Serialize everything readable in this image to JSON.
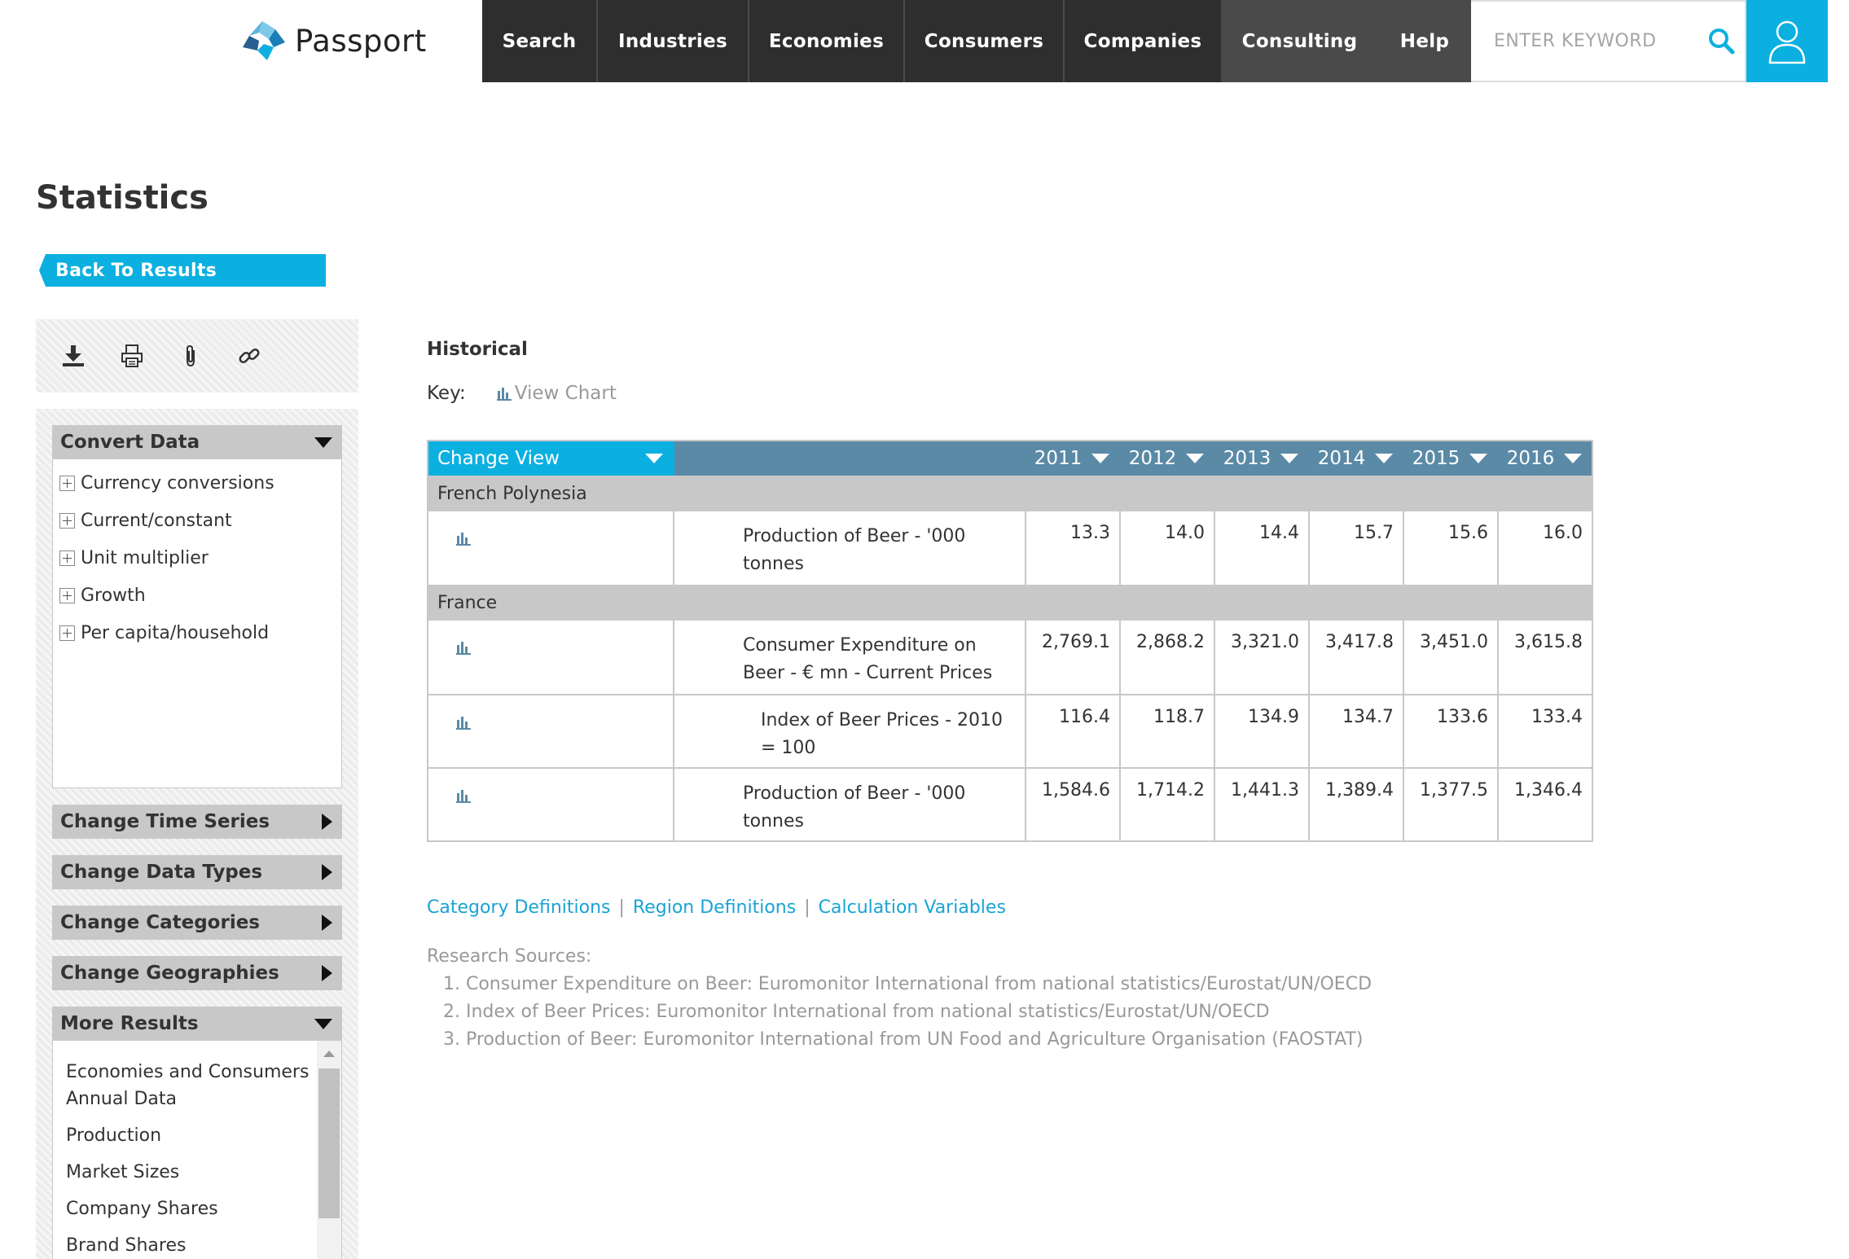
{
  "header": {
    "logo_text": "Passport",
    "nav": [
      {
        "label": "Search",
        "name": "nav-search"
      },
      {
        "label": "Industries",
        "name": "nav-industries"
      },
      {
        "label": "Economies",
        "name": "nav-economies"
      },
      {
        "label": "Consumers",
        "name": "nav-consumers"
      },
      {
        "label": "Companies",
        "name": "nav-companies"
      },
      {
        "label": "Consulting",
        "name": "nav-consulting"
      },
      {
        "label": "Help",
        "name": "nav-help"
      }
    ],
    "search_placeholder": "ENTER KEYWORD",
    "accent_color": "#0bb0e0"
  },
  "page": {
    "title": "Statistics",
    "back_label": "Back To Results"
  },
  "toolbar": {
    "icons": [
      "download-icon",
      "print-icon",
      "attach-icon",
      "link-icon"
    ]
  },
  "sidebar": {
    "convert": {
      "title": "Convert Data",
      "items": [
        "Currency conversions",
        "Current/constant",
        "Unit multiplier",
        "Growth",
        "Per capita/household"
      ]
    },
    "time_series": "Change Time Series",
    "data_types": "Change Data Types",
    "categories": "Change Categories",
    "geographies": "Change Geographies",
    "more": {
      "title": "More Results",
      "items": [
        "Economies and Consumers Annual Data",
        "Production",
        "Market Sizes",
        "Company Shares",
        "Brand Shares"
      ]
    }
  },
  "main": {
    "section_title": "Historical",
    "key_label": "Key:",
    "key_chart_label": "View Chart",
    "change_view_label": "Change View",
    "years": [
      "2011",
      "2012",
      "2013",
      "2014",
      "2015",
      "2016"
    ],
    "groups": [
      {
        "name": "French Polynesia",
        "rows": [
          {
            "label": "Production of Beer - '000 tonnes",
            "values": [
              "13.3",
              "14.0",
              "14.4",
              "15.7",
              "15.6",
              "16.0"
            ]
          }
        ]
      },
      {
        "name": "France",
        "rows": [
          {
            "label": "Consumer Expenditure on Beer - € mn - Current Prices",
            "values": [
              "2,769.1",
              "2,868.2",
              "3,321.0",
              "3,417.8",
              "3,451.0",
              "3,615.8"
            ]
          },
          {
            "label": "Index of Beer Prices - 2010 = 100",
            "values": [
              "116.4",
              "118.7",
              "134.9",
              "134.7",
              "133.6",
              "133.4"
            ],
            "indent": true
          },
          {
            "label": "Production of Beer - '000 tonnes",
            "values": [
              "1,584.6",
              "1,714.2",
              "1,441.3",
              "1,389.4",
              "1,377.5",
              "1,346.4"
            ]
          }
        ]
      }
    ],
    "links": [
      "Category Definitions",
      "Region Definitions",
      "Calculation Variables"
    ],
    "sources_title": "Research Sources:",
    "sources": [
      "1. Consumer Expenditure on Beer: Euromonitor International from national statistics/Eurostat/UN/OECD",
      "2. Index of Beer Prices: Euromonitor International from national statistics/Eurostat/UN/OECD",
      "3. Production of Beer: Euromonitor International from UN Food and Agriculture Organisation (FAOSTAT)"
    ]
  }
}
